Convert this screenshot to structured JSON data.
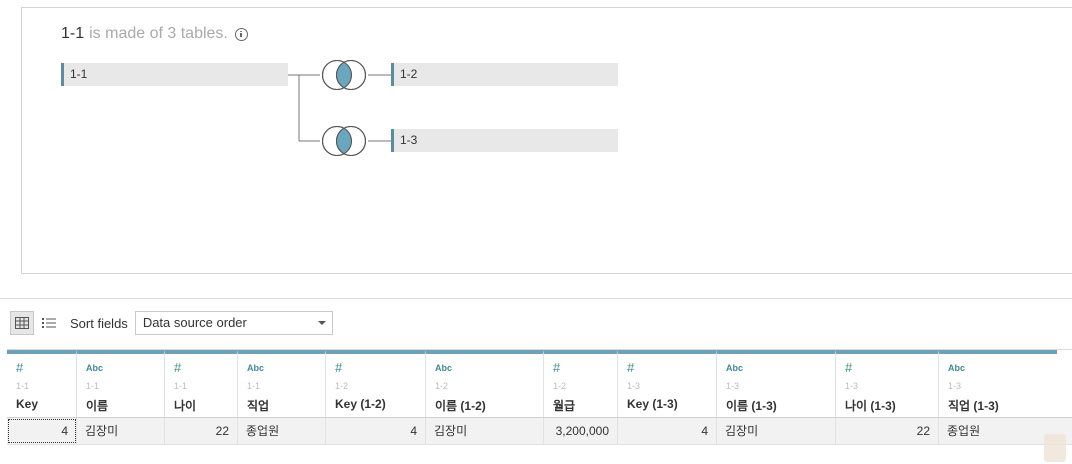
{
  "canvas": {
    "ds_name": "1-1",
    "ds_suffix": "is made of 3 tables.",
    "tables": [
      {
        "label": "1-1"
      },
      {
        "label": "1-2"
      },
      {
        "label": "1-3"
      }
    ],
    "join_color": "#6aa7bf"
  },
  "toolbar": {
    "sort_label": "Sort fields",
    "sort_value": "Data source order"
  },
  "grid": {
    "columns": [
      {
        "type": "#",
        "source": "1-1",
        "name": "Key"
      },
      {
        "type": "Abc",
        "source": "1-1",
        "name": "이름"
      },
      {
        "type": "#",
        "source": "1-1",
        "name": "나이"
      },
      {
        "type": "Abc",
        "source": "1-1",
        "name": "직업"
      },
      {
        "type": "#",
        "source": "1-2",
        "name": "Key (1-2)"
      },
      {
        "type": "Abc",
        "source": "1-2",
        "name": "이름 (1-2)"
      },
      {
        "type": "#",
        "source": "1-2",
        "name": "월급"
      },
      {
        "type": "#",
        "source": "1-3",
        "name": "Key (1-3)"
      },
      {
        "type": "Abc",
        "source": "1-3",
        "name": "이름 (1-3)"
      },
      {
        "type": "#",
        "source": "1-3",
        "name": "나이 (1-3)"
      },
      {
        "type": "Abc",
        "source": "1-3",
        "name": "직업 (1-3)"
      }
    ],
    "rows": [
      [
        "4",
        "김장미",
        "22",
        "종업원",
        "4",
        "김장미",
        "3,200,000",
        "4",
        "김장미",
        "22",
        "종업원"
      ]
    ]
  }
}
